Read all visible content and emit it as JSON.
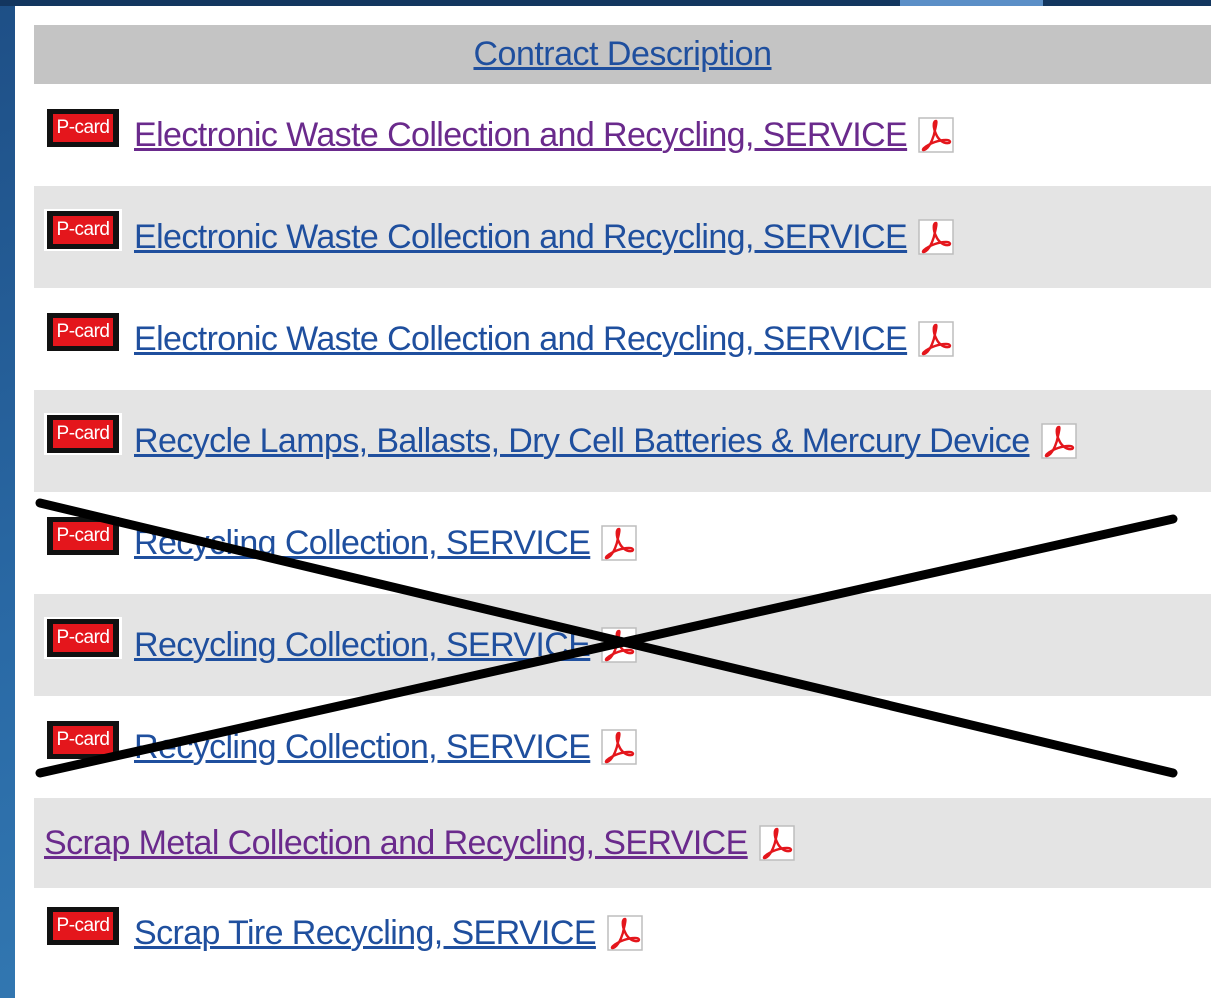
{
  "table": {
    "header": "Contract Description",
    "rows": [
      {
        "pcard": "P-card",
        "link": "Electronic Waste Collection and Recycling, SERVICE",
        "visited": true
      },
      {
        "pcard": "P-card",
        "link": "Electronic Waste Collection and Recycling, SERVICE",
        "visited": false
      },
      {
        "pcard": "P-card",
        "link": "Electronic Waste Collection and Recycling, SERVICE",
        "visited": false
      },
      {
        "pcard": "P-card",
        "link": "Recycle Lamps, Ballasts, Dry Cell Batteries & Mercury Device",
        "visited": false
      },
      {
        "pcard": "P-card",
        "link": "Recycling Collection, SERVICE",
        "visited": false
      },
      {
        "pcard": "P-card",
        "link": "Recycling Collection, SERVICE",
        "visited": false
      },
      {
        "pcard": "P-card",
        "link": "Recycling Collection, SERVICE",
        "visited": false
      },
      {
        "pcard": "",
        "link": "Scrap Metal Collection and Recycling, SERVICE",
        "visited": true
      },
      {
        "pcard": "P-card",
        "link": "Scrap Tire Recycling, SERVICE",
        "visited": false
      }
    ]
  },
  "icons": {
    "pdf": "pdf-icon",
    "pcard": "p-card-badge"
  },
  "colors": {
    "link": "#1f4f9e",
    "visited_link": "#6a2a8c",
    "header_bg": "#c4c4c4",
    "alt_row_bg": "#e4e4e4",
    "pcard_red": "#e4161c"
  }
}
